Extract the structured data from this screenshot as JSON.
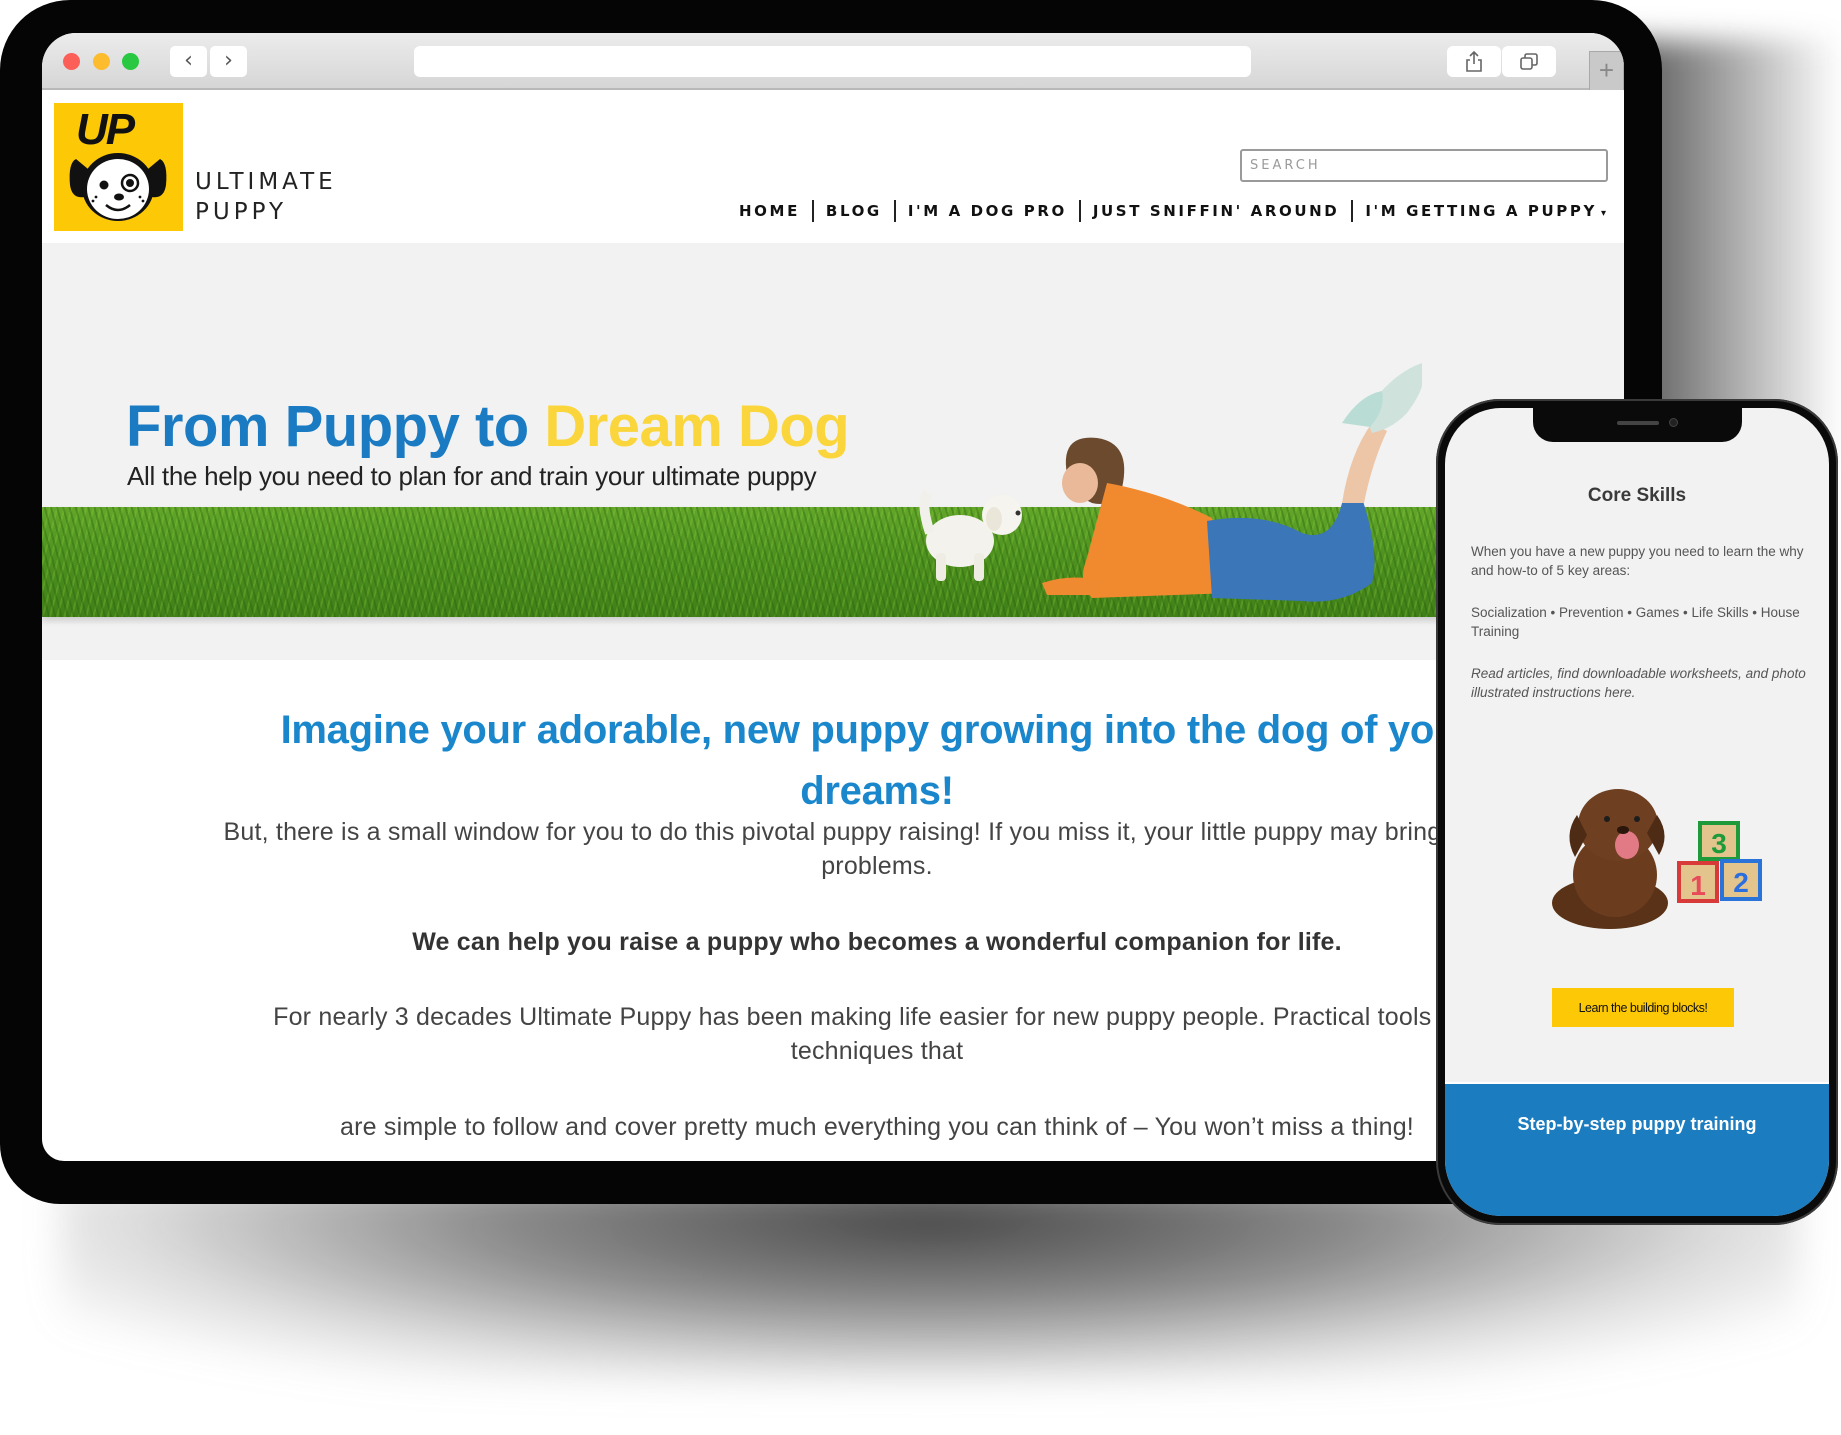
{
  "browser": {
    "back_label": "‹",
    "forward_label": "›",
    "url": "",
    "new_tab_label": "+"
  },
  "site": {
    "logo_mark": "UP",
    "logo_name_line1": "ULTIMATE",
    "logo_name_line2": "PUPPY",
    "search_placeholder": "SEARCH",
    "nav": [
      {
        "label": "HOME"
      },
      {
        "label": "BLOG"
      },
      {
        "label": "I'M A DOG PRO"
      },
      {
        "label": "JUST SNIFFIN' AROUND"
      },
      {
        "label": "I'M GETTING A PUPPY",
        "has_dropdown": true
      }
    ],
    "dropdown_caret": "▾"
  },
  "hero": {
    "title_part1": "From Puppy to ",
    "title_part2": "Dream Dog",
    "subtitle": "All the help you need to plan for and train your ultimate puppy",
    "colors": {
      "blue": "#1a7bc3",
      "yellow": "#fad53c"
    }
  },
  "content": {
    "headline": "Imagine your adorable, new puppy growing into the dog of your dreams!",
    "para1": "But, there is a small window for you to do this pivotal puppy raising! If you miss it, your little puppy may bring you big problems.",
    "para2": "We can help you raise a puppy who becomes a wonderful companion for life.",
    "para3": "For nearly 3 decades Ultimate Puppy has been making life easier for new puppy people. Practical tools and techniques that",
    "para4": "are simple to follow and cover pretty much everything you can think of – You won’t miss a thing!"
  },
  "phone": {
    "title": "Core Skills",
    "intro": "When you have a new puppy you need to learn the why and how-to of 5 key areas:",
    "skills": "Socialization • Prevention • Games • Life Skills • House Training",
    "note": "Read articles, find downloadable worksheets, and photo illustrated instructions here.",
    "blocks": [
      "3",
      "1",
      "2"
    ],
    "cta_label": "Learn the building blocks!",
    "footer_label": "Step-by-step puppy training",
    "colors": {
      "cta": "#fdc806",
      "footer": "#1b7cc0"
    }
  }
}
